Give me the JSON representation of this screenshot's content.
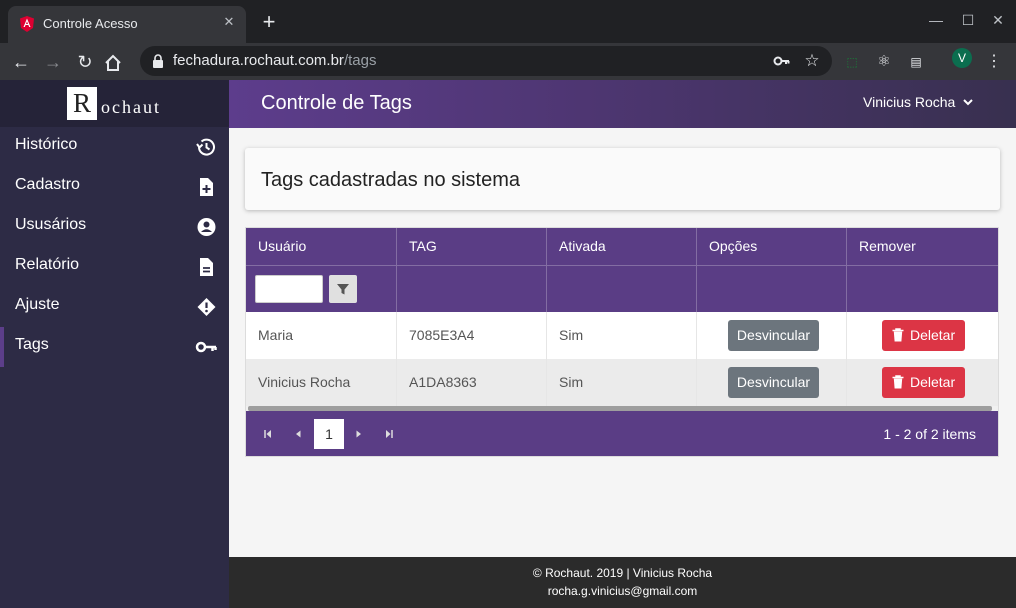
{
  "browser": {
    "tab_title": "Controle Acesso",
    "tab_close": "✕",
    "new_tab": "+",
    "url_host": "fechadura.rochaut.com.br",
    "url_path": "/tags",
    "profile_initial": "V",
    "back": "←",
    "forward": "→",
    "reload": "↻",
    "minimize": "—",
    "maximize": "☐",
    "close": "✕"
  },
  "brand": {
    "initial": "R",
    "text": "ochaut"
  },
  "sidebar": {
    "items": [
      {
        "label": "Histórico",
        "icon": "history-icon"
      },
      {
        "label": "Cadastro",
        "icon": "file-plus-icon"
      },
      {
        "label": "Ususários",
        "icon": "account-circle-icon"
      },
      {
        "label": "Relatório",
        "icon": "document-icon"
      },
      {
        "label": "Ajuste",
        "icon": "alert-icon"
      },
      {
        "label": "Tags",
        "icon": "key-icon",
        "active": true
      }
    ]
  },
  "header": {
    "title": "Controle de Tags",
    "user": "Vinicius Rocha"
  },
  "card": {
    "title": "Tags cadastradas no sistema"
  },
  "grid": {
    "columns": [
      "Usuário",
      "TAG",
      "Ativada",
      "Opções",
      "Remover"
    ],
    "rows": [
      {
        "usuario": "Maria",
        "tag": "7085E3A4",
        "ativada": "Sim",
        "option_label": "Desvincular",
        "remove_label": "Deletar"
      },
      {
        "usuario": "Vinicius Rocha",
        "tag": "A1DA8363",
        "ativada": "Sim",
        "option_label": "Desvincular",
        "remove_label": "Deletar"
      }
    ],
    "pager": {
      "current_page": "1",
      "info": "1 - 2 of 2 items"
    }
  },
  "footer": {
    "line1": "© Rochaut. 2019 | Vinicius Rocha",
    "line2": "rocha.g.vinicius@gmail.com"
  },
  "colors": {
    "accent_purple": "#5a3d85",
    "sidebar_bg": "#2d2b45",
    "danger": "#dc3545",
    "secondary": "#6c757d"
  }
}
